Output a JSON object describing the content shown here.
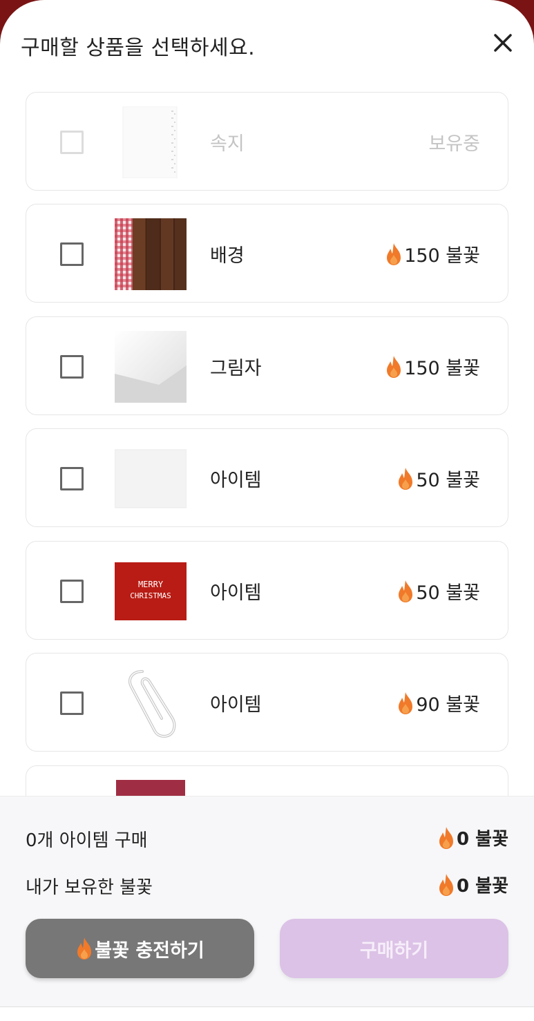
{
  "header": {
    "title": "구매할 상품을 선택하세요."
  },
  "items": [
    {
      "name": "속지",
      "price": "",
      "status": "보유중",
      "owned": true,
      "thumb": "paper-sheet"
    },
    {
      "name": "배경",
      "price": "150 불꽃",
      "status": "",
      "owned": false,
      "thumb": "wood-checker"
    },
    {
      "name": "그림자",
      "price": "150 불꽃",
      "status": "",
      "owned": false,
      "thumb": "shadow"
    },
    {
      "name": "아이템",
      "price": "50 불꽃",
      "status": "",
      "owned": false,
      "thumb": "white-paper"
    },
    {
      "name": "아이템",
      "price": "50 불꽃",
      "status": "",
      "owned": false,
      "thumb": "merry-christmas",
      "thumb_text_1": "MERRY",
      "thumb_text_2": "CHRISTMAS"
    },
    {
      "name": "아이템",
      "price": "90 불꽃",
      "status": "",
      "owned": false,
      "thumb": "paperclip"
    }
  ],
  "footer": {
    "purchase_count_label": "0개 아이템 구매",
    "purchase_total": "0 불꽃",
    "owned_label": "내가 보유한 불꽃",
    "owned_total": "0 불꽃",
    "charge_button": "불꽃 충전하기",
    "buy_button": "구매하기"
  },
  "colors": {
    "backdrop": "#7a1414",
    "flame": "#f07a2a",
    "charge_button": "#777777",
    "buy_button_disabled": "#dcc2e6"
  },
  "icons": [
    "close-icon",
    "flame-icon",
    "checkbox-icon"
  ]
}
